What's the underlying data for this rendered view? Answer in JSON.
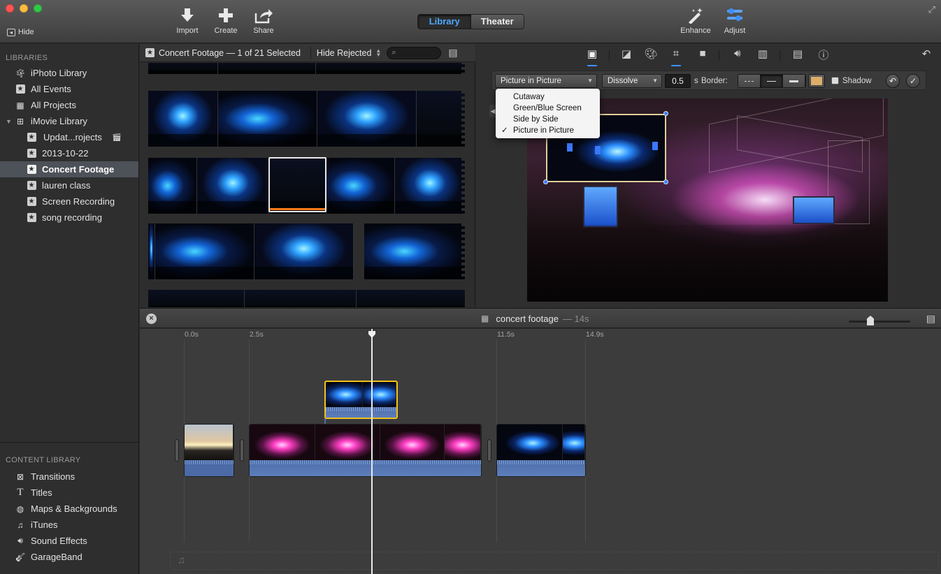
{
  "window": {
    "hide_label": "Hide",
    "toolbar": {
      "import_label": "Import",
      "create_label": "Create",
      "share_label": "Share",
      "enhance_label": "Enhance",
      "adjust_label": "Adjust",
      "mode_library": "Library",
      "mode_theater": "Theater",
      "active_mode": "Library"
    }
  },
  "sidebar": {
    "libraries_header": "LIBRARIES",
    "libraries": [
      {
        "label": "iPhoto Library",
        "icon": "palm-tree-icon"
      },
      {
        "label": "All Events",
        "icon": "star-icon"
      },
      {
        "label": "All Projects",
        "icon": "projects-icon"
      },
      {
        "label": "iMovie Library",
        "icon": "grid-icon"
      },
      {
        "label": "Updat...rojects",
        "icon": "star-icon"
      },
      {
        "label": "2013-10-22",
        "icon": "star-icon"
      },
      {
        "label": "Concert Footage",
        "icon": "star-icon",
        "selected": true
      },
      {
        "label": "lauren class",
        "icon": "star-icon"
      },
      {
        "label": "Screen Recording",
        "icon": "star-icon"
      },
      {
        "label": "song recording",
        "icon": "star-icon"
      }
    ],
    "content_header": "CONTENT LIBRARY",
    "content": [
      {
        "label": "Transitions",
        "icon": "transitions-icon"
      },
      {
        "label": "Titles",
        "icon": "titles-icon"
      },
      {
        "label": "Maps & Backgrounds",
        "icon": "globe-icon"
      },
      {
        "label": "iTunes",
        "icon": "music-note-icon"
      },
      {
        "label": "Sound Effects",
        "icon": "speaker-icon"
      },
      {
        "label": "GarageBand",
        "icon": "guitar-icon"
      }
    ]
  },
  "browser": {
    "title": "Concert Footage — 1 of 21 Selected",
    "filter": "Hide Rejected",
    "search_placeholder": ""
  },
  "viewer": {
    "overlay_style": "Picture in Picture",
    "transition": "Dissolve",
    "duration_value": "0.5",
    "duration_unit": "s",
    "border_label": "Border:",
    "border_color": "#dcae68",
    "shadow_label": "Shadow",
    "overlay_menu": [
      {
        "label": "Cutaway",
        "checked": false
      },
      {
        "label": "Green/Blue Screen",
        "checked": false
      },
      {
        "label": "Side by Side",
        "checked": false
      },
      {
        "label": "Picture in Picture",
        "checked": true
      }
    ],
    "check_mark": "✓"
  },
  "timeline": {
    "project_name": "concert footage",
    "duration": "— 14s",
    "ticks": [
      "0.0s",
      "2.5s",
      "11.5s",
      "14.9s"
    ]
  },
  "colors": {
    "accent": "#3e94ff",
    "selection": "#f2c21b",
    "clip_audio": "#5c7dbb"
  }
}
